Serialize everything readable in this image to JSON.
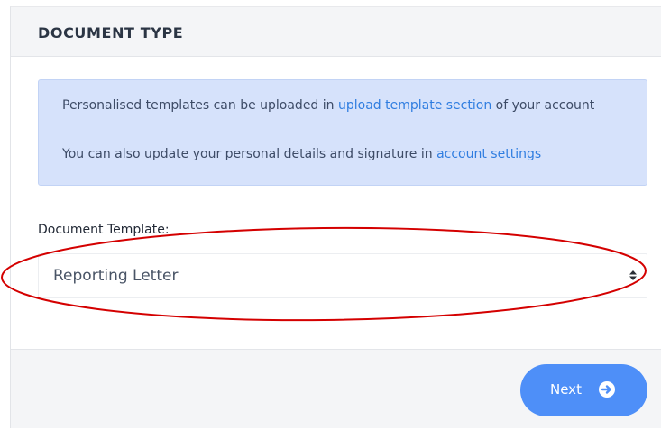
{
  "card": {
    "title": "DOCUMENT TYPE"
  },
  "info": {
    "line1_prefix": "Personalised templates can be uploaded in ",
    "line1_link": "upload template section",
    "line1_suffix": " of your account",
    "line2_prefix": "You can also update your personal details and signature in ",
    "line2_link": "account settings"
  },
  "field": {
    "label": "Document Template:",
    "selected_value": "Reporting Letter",
    "icon": "select-arrows-icon"
  },
  "footer": {
    "next_label": "Next",
    "next_icon": "arrow-circle-right-icon"
  },
  "colors": {
    "info_background": "#d6e2fb",
    "link": "#2f7de0",
    "button": "#4e8ff8",
    "annotation": "#d40000"
  }
}
